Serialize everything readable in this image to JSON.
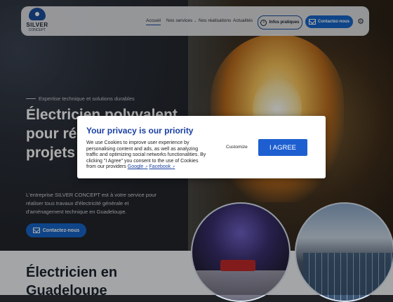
{
  "header": {
    "logo_word": "SILVER",
    "logo_sub": "CONCEPT",
    "nav": [
      "Accueil",
      "Nos services",
      "Nos réalisations",
      "Actualités"
    ],
    "info_label": "Infos pratiques",
    "contact_label": "Contactez-nous"
  },
  "hero": {
    "tagline": "Expertise technique et solutions durables",
    "heading": "Électricien polyvalent pour réussir vos projets",
    "intro": "L'entreprise SILVER CONCEPT est à votre service pour réaliser tous travaux d'électricité générale et d'aménagement technique en Guadeloupe.",
    "cta": "Contactez-nous"
  },
  "section2": {
    "heading": "Électricien en Guadeloupe"
  },
  "consent": {
    "title": "Your privacy is our priority",
    "body": "We use Cookies to improve user experience by personalising content and ads, as well as analyzing traffic and optimizing social networks functionalities. By clicking \"I Agree\" you consent to the use of Cookies from our providers",
    "link_google": "Google",
    "separator": " ",
    "link_facebook": "Facebook",
    "customize": "Customize",
    "agree": "I AGREE"
  },
  "colors": {
    "brand_blue": "#1766c9",
    "consent_title": "#1a3fa3",
    "agree_button": "#1d5fd0"
  },
  "icons": [
    "info-icon",
    "mail-icon",
    "gear-icon",
    "external-link-icon"
  ]
}
